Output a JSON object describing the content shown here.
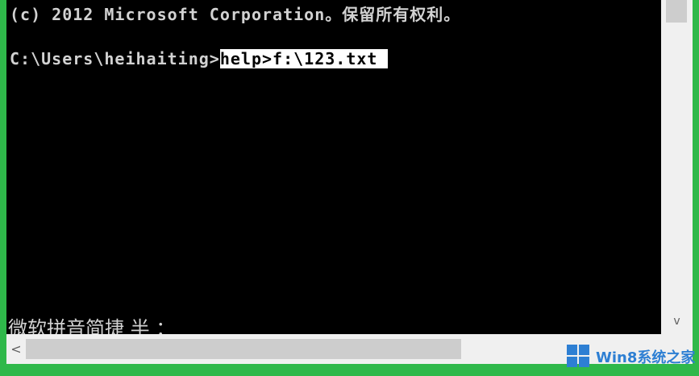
{
  "console": {
    "copyright_line": "(c) 2012 Microsoft Corporation。保留所有权利。",
    "prompt": "C:\\Users\\heihaiting>",
    "selected_command": "help>f:\\123.txt ",
    "ime_status": "微软拼音简捷 半 ："
  },
  "scrollbars": {
    "up_arrow": "^",
    "down_arrow": "v",
    "left_arrow": "<"
  },
  "watermark": {
    "text": "Win8系统之家",
    "icon": "windows-logo-icon",
    "color": "#2d7fd3"
  },
  "colors": {
    "frame": "#2fb84a",
    "console_bg": "#000000",
    "console_text": "#d2d2d2",
    "selection_bg": "#ffffff"
  }
}
